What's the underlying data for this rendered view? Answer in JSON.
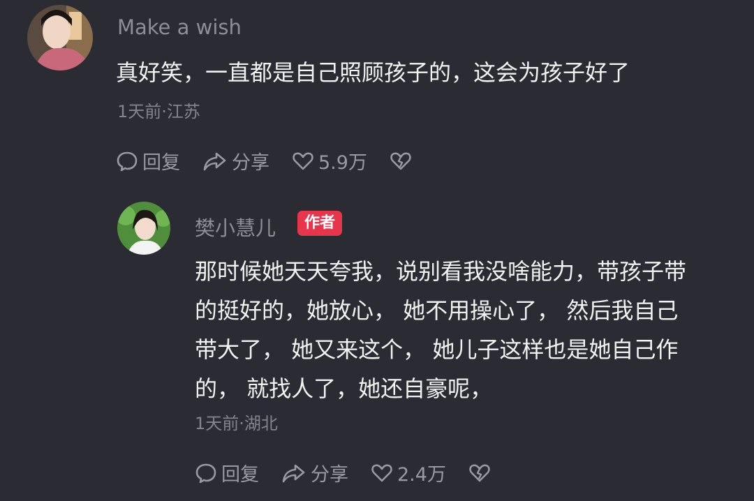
{
  "comment": {
    "username": "Make a wish",
    "text": "真好笑，一直都是自己照顾孩子的，这会为孩子好了",
    "meta": "1天前·江苏",
    "actions": {
      "reply": "回复",
      "share": "分享",
      "likes": "5.9万"
    }
  },
  "reply": {
    "username": "樊小慧儿",
    "badge": "作者",
    "lines": [
      "那时候她天天夸我，说别看我没啥能力，带孩子带",
      "的挺好的，她放心， 她不用操心了， 然后我自己",
      "带大了， 她又来这个， 她儿子这样也是她自己作",
      "的， 就找人了，她还自豪呢，"
    ],
    "meta": "1天前·湖北",
    "actions": {
      "reply": "回复",
      "share": "分享",
      "likes": "2.4万"
    }
  },
  "colors": {
    "background": "#2b2c33",
    "badge": "#e8354c"
  }
}
